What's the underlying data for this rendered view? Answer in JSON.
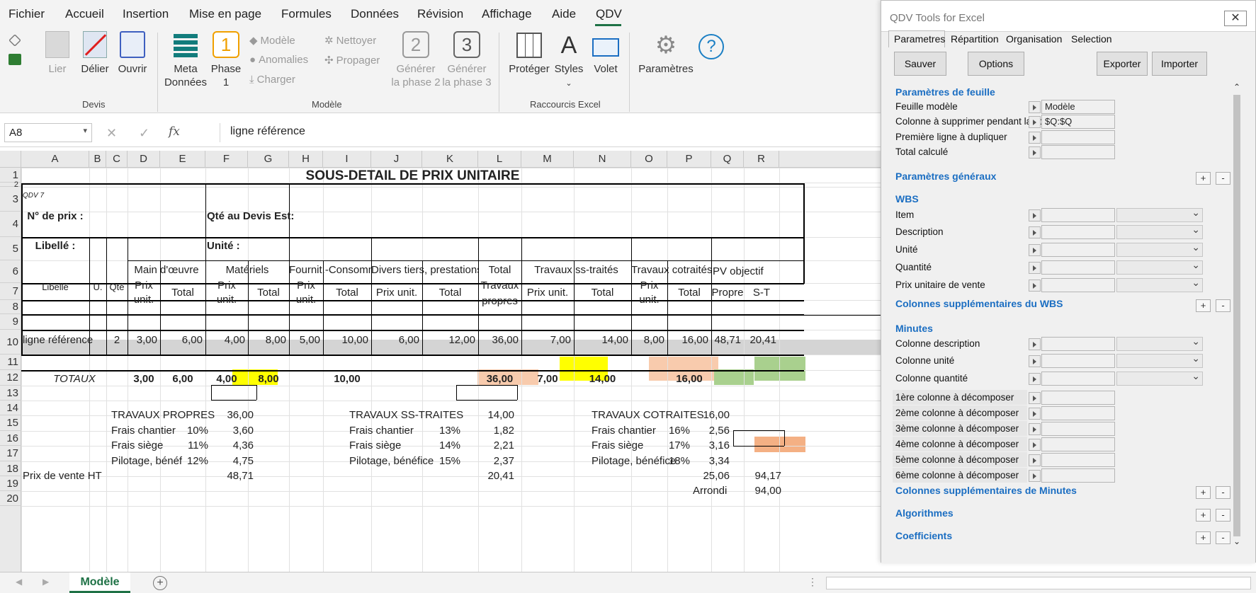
{
  "menu": {
    "fichier": "Fichier",
    "accueil": "Accueil",
    "insertion": "Insertion",
    "mise_en_page": "Mise en page",
    "formules": "Formules",
    "donnees": "Données",
    "revision": "Révision",
    "affichage": "Affichage",
    "aide": "Aide",
    "qdv": "QDV"
  },
  "ribbon": {
    "lier": "Lier",
    "delier": "Délier",
    "ouvrir": "Ouvrir",
    "group_devis": "Devis",
    "meta1": "Meta",
    "meta2": "Données",
    "phase1": "Phase",
    "phase1b": "1",
    "phase1_num": "1",
    "modele": "Modèle",
    "anomalies": "Anomalies",
    "charger": "Charger",
    "nettoyer": "Nettoyer",
    "propager": "Propager",
    "gen2a": "Générer",
    "gen2b": "la phase 2",
    "gen2_num": "2",
    "gen3a": "Générer",
    "gen3b": "la phase 3",
    "gen3_num": "3",
    "group_modele": "Modèle",
    "proteger": "Protéger",
    "styles": "Styles",
    "volet": "Volet",
    "group_raccourcis": "Raccourcis Excel",
    "parametres": "Paramètres"
  },
  "formula": {
    "namebox": "A8",
    "fx": "fx",
    "content": "ligne référence"
  },
  "columns": [
    "A",
    "B",
    "C",
    "D",
    "E",
    "F",
    "G",
    "H",
    "I",
    "J",
    "K",
    "L",
    "M",
    "N",
    "O",
    "P",
    "Q",
    "R"
  ],
  "rows": [
    "1",
    "2",
    "3",
    "4",
    "5",
    "6",
    "7",
    "8",
    "9",
    "10",
    "11",
    "12",
    "13",
    "14",
    "15",
    "16",
    "17",
    "18",
    "19",
    "20"
  ],
  "sheet": {
    "title": "SOUS-DETAIL DE PRIX UNITAIRE",
    "qdv7": "QDV 7",
    "no_prix": "N° de prix :",
    "qte_devis": "Qté au Devis Est:",
    "libelle_lbl": "Libellé :",
    "unite_lbl": "Unité :",
    "h_libelle": "Libellé",
    "h_u": "U.",
    "h_qte": "Qté",
    "h_mo": "Main d'œuvre",
    "h_mat": "Matériels",
    "h_fourn": "Fournit.-Consomm",
    "h_divers": "Divers tiers, prestations",
    "h_total": "Total",
    "h_travaux": "Travaux",
    "h_propres": "propres",
    "h_sst": "Travaux ss-traités",
    "h_cot": "Travaux cotraités",
    "h_pv": "PV objectif",
    "h_prix": "Prix",
    "h_unit": "unit.",
    "h_tot": "Total",
    "h_prixunit": "Prix unit.",
    "h_propre": "Propre",
    "h_st": "S-T",
    "row8": {
      "lib": "ligne référence",
      "qte": "2",
      "d": "3,00",
      "e": "6,00",
      "f": "4,00",
      "g": "8,00",
      "h": "5,00",
      "i": "10,00",
      "j": "6,00",
      "k": "12,00",
      "l": "36,00",
      "m": "7,00",
      "n": "14,00",
      "o": "8,00",
      "p": "16,00",
      "q": "48,71",
      "r": "20,41"
    },
    "totaux": {
      "lbl": "TOTAUX",
      "d": "3,00",
      "e": "6,00",
      "f": "4,00",
      "g": "8,00",
      "i": "10,00",
      "l": "36,00",
      "m": "7,00",
      "n": "14,00",
      "p": "16,00"
    },
    "tp": {
      "lbl": "TRAVAUX PROPRES",
      "val": "36,00",
      "fc": "Frais chantier",
      "fc_pct": "10%",
      "fc_val": "3,60",
      "fs": "Frais siège",
      "fs_pct": "11%",
      "fs_val": "4,36",
      "pb": "Pilotage, bénéf",
      "pb_pct": "12%",
      "pb_val": "4,75"
    },
    "st": {
      "lbl": "TRAVAUX SS-TRAITES",
      "val": "14,00",
      "fc": "Frais chantier",
      "fc_pct": "13%",
      "fc_val": "1,82",
      "fs": "Frais siège",
      "fs_pct": "14%",
      "fs_val": "2,21",
      "pb": "Pilotage, bénéfice",
      "pb_pct": "15%",
      "pb_val": "2,37"
    },
    "ct": {
      "lbl": "TRAVAUX COTRAITES",
      "val": "16,00",
      "fc": "Frais chantier",
      "fc_pct": "16%",
      "fc_val": "2,56",
      "fs": "Frais siège",
      "fs_pct": "17%",
      "fs_val": "3,16",
      "pb": "Pilotage, bénéfice",
      "pb_pct": "18%",
      "pb_val": "3,34"
    },
    "pv": {
      "lbl": "Prix de vente HT",
      "tp": "48,71",
      "st": "20,41",
      "ct": "25,06",
      "total": "94,17",
      "arrondi": "Arrondi",
      "arrondi_val": "94,00"
    }
  },
  "tabs": {
    "sheet": "Modèle",
    "add": "+"
  },
  "panel": {
    "title": "QDV Tools for Excel",
    "tabs": [
      "Parametres",
      "Répartition",
      "Organisation",
      "Selection"
    ],
    "sauver": "Sauver",
    "options": "Options",
    "exporter": "Exporter",
    "importer": "Importer",
    "s_feuille": "Paramètres de feuille",
    "feuille_modele": "Feuille modèle",
    "feuille_modele_val": "Modèle",
    "col_suppr": "Colonne à supprimer pendant la co",
    "col_suppr_val": "$Q:$Q",
    "premiere": "Première ligne à dupliquer",
    "total_calc": "Total calculé",
    "s_generaux": "Paramètres généraux",
    "s_wbs": "WBS",
    "item": "Item",
    "description": "Description",
    "unite": "Unité",
    "quantite": "Quantité",
    "pu_vente": "Prix unitaire de vente",
    "s_colwbs": "Colonnes supplémentaires du WBS",
    "s_minutes": "Minutes",
    "col_desc": "Colonne description",
    "col_unite": "Colonne unité",
    "col_qte": "Colonne quantité",
    "c1": "1ère colonne à décomposer",
    "c2": "2ème colonne à décomposer",
    "c3": "3ème colonne à décomposer",
    "c4": "4ème colonne à décomposer",
    "c5": "5ème colonne à décomposer",
    "c6": "6ème colonne à décomposer",
    "s_colmin": "Colonnes supplémentaires de Minutes",
    "s_algo": "Algorithmes",
    "s_coef": "Coefficients",
    "plus": "+",
    "minus": "-"
  },
  "colors": {
    "yellow": "#ffff00",
    "salmon": "#f8cbad",
    "green": "#a9d08e",
    "orange": "#f4b084",
    "accent": "#1e7145",
    "section": "#1b6ec2"
  }
}
